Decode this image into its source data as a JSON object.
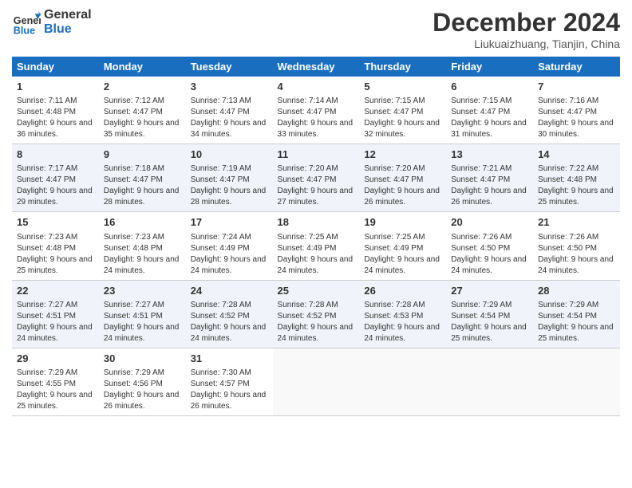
{
  "header": {
    "logo_line1": "General",
    "logo_line2": "Blue",
    "month": "December 2024",
    "location": "Liukuaizhuang, Tianjin, China"
  },
  "days_of_week": [
    "Sunday",
    "Monday",
    "Tuesday",
    "Wednesday",
    "Thursday",
    "Friday",
    "Saturday"
  ],
  "weeks": [
    [
      {
        "day": "1",
        "sunrise": "Sunrise: 7:11 AM",
        "sunset": "Sunset: 4:48 PM",
        "daylight": "Daylight: 9 hours and 36 minutes."
      },
      {
        "day": "2",
        "sunrise": "Sunrise: 7:12 AM",
        "sunset": "Sunset: 4:47 PM",
        "daylight": "Daylight: 9 hours and 35 minutes."
      },
      {
        "day": "3",
        "sunrise": "Sunrise: 7:13 AM",
        "sunset": "Sunset: 4:47 PM",
        "daylight": "Daylight: 9 hours and 34 minutes."
      },
      {
        "day": "4",
        "sunrise": "Sunrise: 7:14 AM",
        "sunset": "Sunset: 4:47 PM",
        "daylight": "Daylight: 9 hours and 33 minutes."
      },
      {
        "day": "5",
        "sunrise": "Sunrise: 7:15 AM",
        "sunset": "Sunset: 4:47 PM",
        "daylight": "Daylight: 9 hours and 32 minutes."
      },
      {
        "day": "6",
        "sunrise": "Sunrise: 7:15 AM",
        "sunset": "Sunset: 4:47 PM",
        "daylight": "Daylight: 9 hours and 31 minutes."
      },
      {
        "day": "7",
        "sunrise": "Sunrise: 7:16 AM",
        "sunset": "Sunset: 4:47 PM",
        "daylight": "Daylight: 9 hours and 30 minutes."
      }
    ],
    [
      {
        "day": "8",
        "sunrise": "Sunrise: 7:17 AM",
        "sunset": "Sunset: 4:47 PM",
        "daylight": "Daylight: 9 hours and 29 minutes."
      },
      {
        "day": "9",
        "sunrise": "Sunrise: 7:18 AM",
        "sunset": "Sunset: 4:47 PM",
        "daylight": "Daylight: 9 hours and 28 minutes."
      },
      {
        "day": "10",
        "sunrise": "Sunrise: 7:19 AM",
        "sunset": "Sunset: 4:47 PM",
        "daylight": "Daylight: 9 hours and 28 minutes."
      },
      {
        "day": "11",
        "sunrise": "Sunrise: 7:20 AM",
        "sunset": "Sunset: 4:47 PM",
        "daylight": "Daylight: 9 hours and 27 minutes."
      },
      {
        "day": "12",
        "sunrise": "Sunrise: 7:20 AM",
        "sunset": "Sunset: 4:47 PM",
        "daylight": "Daylight: 9 hours and 26 minutes."
      },
      {
        "day": "13",
        "sunrise": "Sunrise: 7:21 AM",
        "sunset": "Sunset: 4:47 PM",
        "daylight": "Daylight: 9 hours and 26 minutes."
      },
      {
        "day": "14",
        "sunrise": "Sunrise: 7:22 AM",
        "sunset": "Sunset: 4:48 PM",
        "daylight": "Daylight: 9 hours and 25 minutes."
      }
    ],
    [
      {
        "day": "15",
        "sunrise": "Sunrise: 7:23 AM",
        "sunset": "Sunset: 4:48 PM",
        "daylight": "Daylight: 9 hours and 25 minutes."
      },
      {
        "day": "16",
        "sunrise": "Sunrise: 7:23 AM",
        "sunset": "Sunset: 4:48 PM",
        "daylight": "Daylight: 9 hours and 24 minutes."
      },
      {
        "day": "17",
        "sunrise": "Sunrise: 7:24 AM",
        "sunset": "Sunset: 4:49 PM",
        "daylight": "Daylight: 9 hours and 24 minutes."
      },
      {
        "day": "18",
        "sunrise": "Sunrise: 7:25 AM",
        "sunset": "Sunset: 4:49 PM",
        "daylight": "Daylight: 9 hours and 24 minutes."
      },
      {
        "day": "19",
        "sunrise": "Sunrise: 7:25 AM",
        "sunset": "Sunset: 4:49 PM",
        "daylight": "Daylight: 9 hours and 24 minutes."
      },
      {
        "day": "20",
        "sunrise": "Sunrise: 7:26 AM",
        "sunset": "Sunset: 4:50 PM",
        "daylight": "Daylight: 9 hours and 24 minutes."
      },
      {
        "day": "21",
        "sunrise": "Sunrise: 7:26 AM",
        "sunset": "Sunset: 4:50 PM",
        "daylight": "Daylight: 9 hours and 24 minutes."
      }
    ],
    [
      {
        "day": "22",
        "sunrise": "Sunrise: 7:27 AM",
        "sunset": "Sunset: 4:51 PM",
        "daylight": "Daylight: 9 hours and 24 minutes."
      },
      {
        "day": "23",
        "sunrise": "Sunrise: 7:27 AM",
        "sunset": "Sunset: 4:51 PM",
        "daylight": "Daylight: 9 hours and 24 minutes."
      },
      {
        "day": "24",
        "sunrise": "Sunrise: 7:28 AM",
        "sunset": "Sunset: 4:52 PM",
        "daylight": "Daylight: 9 hours and 24 minutes."
      },
      {
        "day": "25",
        "sunrise": "Sunrise: 7:28 AM",
        "sunset": "Sunset: 4:52 PM",
        "daylight": "Daylight: 9 hours and 24 minutes."
      },
      {
        "day": "26",
        "sunrise": "Sunrise: 7:28 AM",
        "sunset": "Sunset: 4:53 PM",
        "daylight": "Daylight: 9 hours and 24 minutes."
      },
      {
        "day": "27",
        "sunrise": "Sunrise: 7:29 AM",
        "sunset": "Sunset: 4:54 PM",
        "daylight": "Daylight: 9 hours and 25 minutes."
      },
      {
        "day": "28",
        "sunrise": "Sunrise: 7:29 AM",
        "sunset": "Sunset: 4:54 PM",
        "daylight": "Daylight: 9 hours and 25 minutes."
      }
    ],
    [
      {
        "day": "29",
        "sunrise": "Sunrise: 7:29 AM",
        "sunset": "Sunset: 4:55 PM",
        "daylight": "Daylight: 9 hours and 25 minutes."
      },
      {
        "day": "30",
        "sunrise": "Sunrise: 7:29 AM",
        "sunset": "Sunset: 4:56 PM",
        "daylight": "Daylight: 9 hours and 26 minutes."
      },
      {
        "day": "31",
        "sunrise": "Sunrise: 7:30 AM",
        "sunset": "Sunset: 4:57 PM",
        "daylight": "Daylight: 9 hours and 26 minutes."
      },
      null,
      null,
      null,
      null
    ]
  ]
}
